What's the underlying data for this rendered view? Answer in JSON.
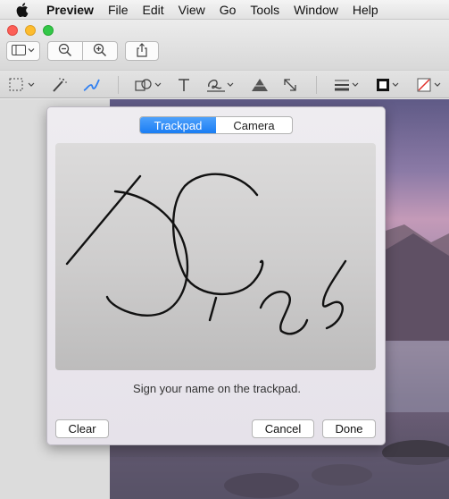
{
  "menubar": {
    "items": [
      "Preview",
      "File",
      "Edit",
      "View",
      "Go",
      "Tools",
      "Window",
      "Help"
    ]
  },
  "toolbar": {
    "icons": [
      "sidebar-icon",
      "zoom-out-icon",
      "zoom-in-icon",
      "share-icon"
    ],
    "markup_icons": [
      "selection-icon",
      "instant-alpha-icon",
      "sketch-icon",
      "shapes-icon",
      "text-icon",
      "sign-icon",
      "adjust-color-icon",
      "adjust-size-icon",
      "shape-style-icon",
      "border-color-icon",
      "fill-color-icon"
    ]
  },
  "signature_sheet": {
    "tabs": [
      {
        "label": "Trackpad",
        "active": true
      },
      {
        "label": "Camera",
        "active": false
      }
    ],
    "hint": "Sign your name on the trackpad.",
    "clear_label": "Clear",
    "cancel_label": "Cancel",
    "done_label": "Done"
  },
  "colors": {
    "accent": "#1a7df4",
    "close": "#fc5f57",
    "minimize": "#fdbc2e",
    "zoom": "#33c748"
  }
}
